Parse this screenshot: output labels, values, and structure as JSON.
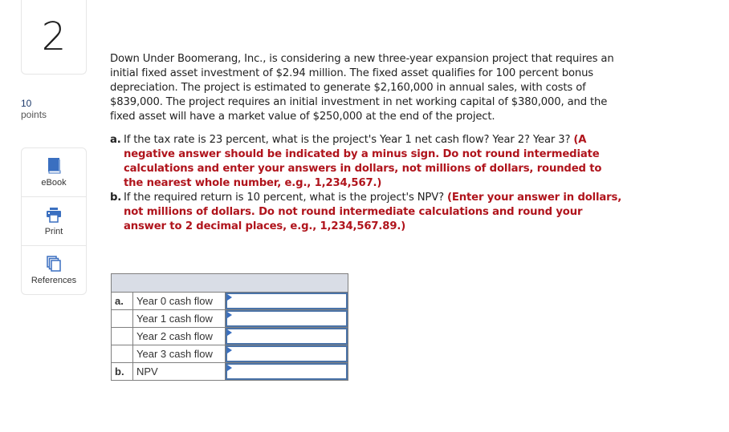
{
  "question": {
    "number": "2",
    "points_value": "10",
    "points_label": "points",
    "body": "Down Under Boomerang, Inc., is considering a new three-year expansion project that requires an initial fixed asset investment of $2.94 million. The fixed asset qualifies for 100 percent bonus depreciation. The project is estimated to generate $2,160,000 in annual sales, with costs of $839,000. The project requires an initial investment in net working capital of $380,000, and the fixed asset will have a market value of $250,000 at the end of the project.",
    "parts": [
      {
        "letter": "a.",
        "text": "If the tax rate is 23 percent, what is the project's Year 1 net cash flow? Year 2? Year 3?",
        "instruction": "(A negative answer should be indicated by a minus sign. Do not round intermediate calculations and enter your answers in dollars, not millions of dollars, rounded to the nearest whole number, e.g., 1,234,567.)"
      },
      {
        "letter": "b.",
        "text": "If the required return is 10 percent, what is the project's NPV?",
        "instruction": "(Enter your answer in dollars, not millions of dollars. Do not round intermediate calculations and round your answer to 2 decimal places, e.g., 1,234,567.89.)"
      }
    ]
  },
  "tools": [
    {
      "label": "eBook",
      "icon": "book-icon"
    },
    {
      "label": "Print",
      "icon": "printer-icon"
    },
    {
      "label": "References",
      "icon": "documents-icon"
    }
  ],
  "answer_table": {
    "rows": [
      {
        "letter": "a.",
        "label": "Year 0 cash flow",
        "value": ""
      },
      {
        "letter": "",
        "label": "Year 1 cash flow",
        "value": ""
      },
      {
        "letter": "",
        "label": "Year 2 cash flow",
        "value": ""
      },
      {
        "letter": "",
        "label": "Year 3 cash flow",
        "value": ""
      },
      {
        "letter": "b.",
        "label": "NPV",
        "value": ""
      }
    ]
  },
  "colors": {
    "instruction_red": "#b0141c",
    "input_border": "#4a73a8",
    "table_header_bg": "#d9dde6",
    "icon_blue": "#3a6fc0"
  }
}
